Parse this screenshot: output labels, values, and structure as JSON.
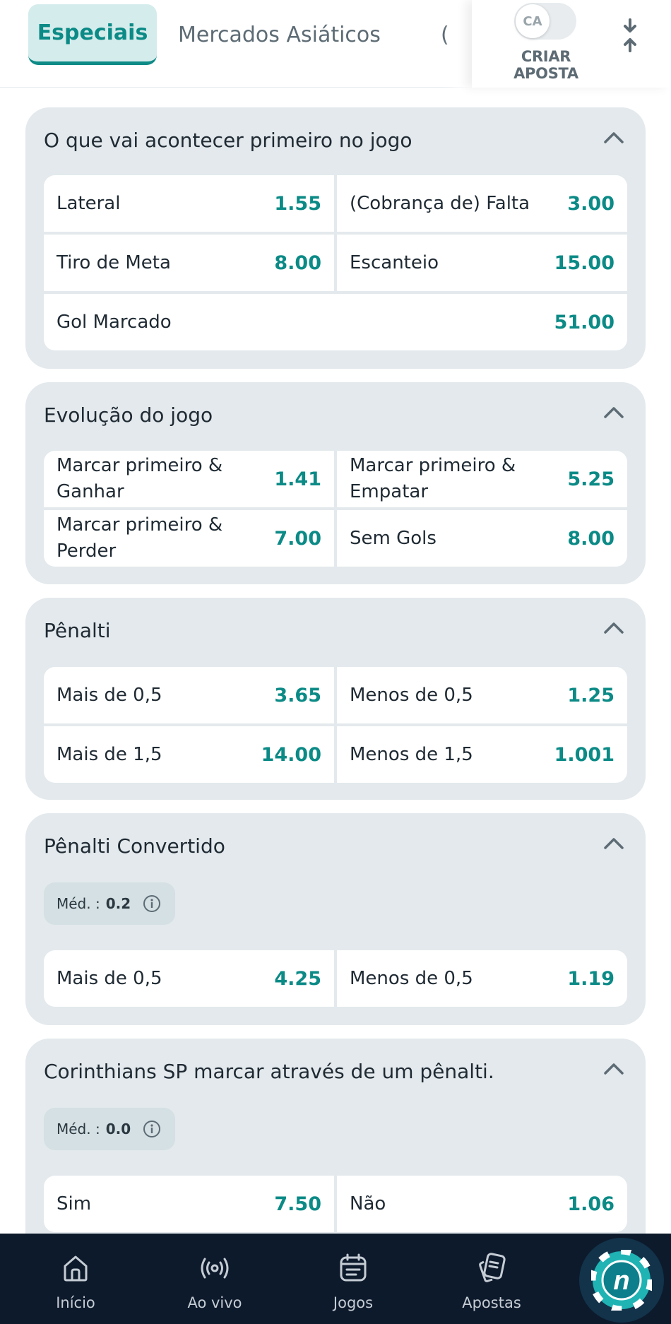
{
  "tabs": [
    {
      "label": "Especiais",
      "active": true
    },
    {
      "label": "Mercados Asiáticos",
      "active": false
    },
    {
      "label": "(",
      "active": false
    }
  ],
  "criar_aposta": {
    "toggle_text": "CA",
    "label": "CRIAR APOSTA"
  },
  "markets": [
    {
      "title": "O que vai acontecer primeiro no jogo",
      "rows": [
        [
          {
            "label": "Lateral",
            "odd": "1.55"
          },
          {
            "label": "(Cobrança de) Falta",
            "odd": "3.00"
          }
        ],
        [
          {
            "label": "Tiro de Meta",
            "odd": "8.00"
          },
          {
            "label": "Escanteio",
            "odd": "15.00"
          }
        ],
        [
          {
            "label": "Gol Marcado",
            "odd": "51.00"
          }
        ]
      ]
    },
    {
      "title": "Evolução do jogo",
      "rows": [
        [
          {
            "label": "Marcar primeiro & Ganhar",
            "odd": "1.41"
          },
          {
            "label": "Marcar primeiro & Empatar",
            "odd": "5.25"
          }
        ],
        [
          {
            "label": "Marcar primeiro & Perder",
            "odd": "7.00"
          },
          {
            "label": "Sem Gols",
            "odd": "8.00"
          }
        ]
      ]
    },
    {
      "title": "Pênalti",
      "rows": [
        [
          {
            "label": "Mais de 0,5",
            "odd": "3.65"
          },
          {
            "label": "Menos de 0,5",
            "odd": "1.25"
          }
        ],
        [
          {
            "label": "Mais de 1,5",
            "odd": "14.00"
          },
          {
            "label": "Menos de 1,5",
            "odd": "1.001"
          }
        ]
      ]
    },
    {
      "title": "Pênalti Convertido",
      "avg_label": "Méd. :",
      "avg_value": "0.2",
      "rows": [
        [
          {
            "label": "Mais de 0,5",
            "odd": "4.25"
          },
          {
            "label": "Menos de 0,5",
            "odd": "1.19"
          }
        ]
      ]
    },
    {
      "title": "Corinthians SP marcar através de um pênalti.",
      "avg_label": "Méd. :",
      "avg_value": "0.0",
      "rows": [
        [
          {
            "label": "Sim",
            "odd": "7.50"
          },
          {
            "label": "Não",
            "odd": "1.06"
          }
        ]
      ]
    }
  ],
  "bottom_nav": [
    {
      "label": "Início",
      "icon": "home-icon"
    },
    {
      "label": "Ao vivo",
      "icon": "live-broadcast-icon"
    },
    {
      "label": "Jogos",
      "icon": "calendar-list-icon"
    },
    {
      "label": "Apostas",
      "icon": "bet-slips-icon"
    }
  ],
  "fab": {
    "icon": "n-chip-icon",
    "text": "n"
  },
  "colors": {
    "accent": "#0b8a86",
    "card_bg": "#e3e9ec",
    "nav_bg": "#0d1a2c"
  }
}
